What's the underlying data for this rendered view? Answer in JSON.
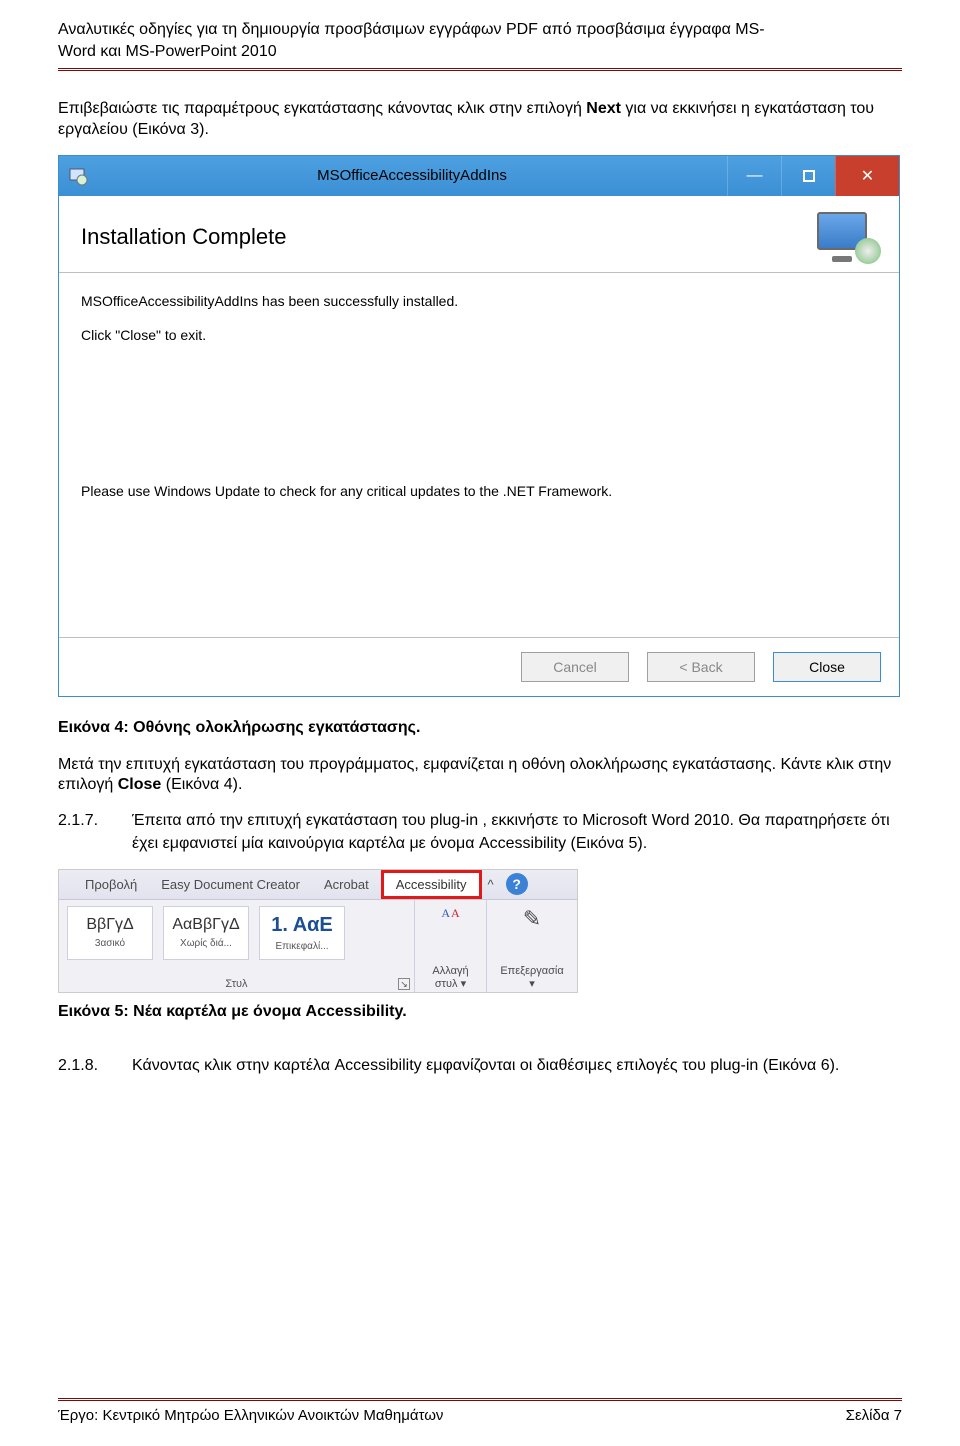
{
  "header": {
    "title_line1": "Αναλυτικές οδηγίες για τη δημιουργία προσβάσιμων εγγράφων PDF από προσβάσιμα έγγραφα MS-",
    "title_line2": "Word και MS-PowerPoint 2010"
  },
  "intro_para_pre": "Επιβεβαιώστε τις παραμέτρους εγκατάστασης κάνοντας κλικ στην επιλογή ",
  "intro_para_bold": "Next",
  "intro_para_post": " για να εκκινήσει η εγκατάσταση του εργαλείου (Εικόνα 3).",
  "installer": {
    "window_title": "MSOfficeAccessibilityAddIns",
    "heading": "Installation Complete",
    "line1": "MSOfficeAccessibilityAddIns has been successfully installed.",
    "line2": "Click \"Close\" to exit.",
    "line3": "Please use Windows Update to check for any critical updates to the .NET Framework.",
    "btn_cancel": "Cancel",
    "btn_back": "< Back",
    "btn_close": "Close"
  },
  "caption4": "Εικόνα 4: Οθόνης ολοκλήρωσης εγκατάστασης.",
  "para_after4_pre": "Μετά την επιτυχή εγκατάσταση του προγράμματος, εμφανίζεται η οθόνη ολοκλήρωσης εγκατάστασης. Κάντε κλικ στην επιλογή ",
  "para_after4_bold": "Close",
  "para_after4_post": " (Εικόνα 4).",
  "step217": {
    "num": "2.1.7.",
    "text": "Έπειτα από την επιτυχή εγκατάσταση του plug-in , εκκινήστε το Microsoft Word 2010. Θα παρατηρήσετε ότι έχει εμφανιστεί μία καινούργια καρτέλα με όνομα Accessibility (Εικόνα 5)."
  },
  "ribbon": {
    "tabs": {
      "view": "Προβολή",
      "edc": "Easy Document Creator",
      "acrobat": "Acrobat",
      "accessibility": "Accessibility",
      "chev": "^"
    },
    "styles": {
      "s1_sample": "ΒβΓγΔ",
      "s1_label": "3ασικό",
      "s2_sample": "ΑαΒβΓγΔ",
      "s2_label": "Χωρίς διά...",
      "s3_sample": "1. ΑαE",
      "s3_label": "Επικεφαλί...",
      "group_label": "Στυλ"
    },
    "change": {
      "label1": "Αλλαγή",
      "label2": "στυλ ▾"
    },
    "edit": {
      "label": "Επεξεργασία",
      "sub": "▾"
    }
  },
  "caption5": "Εικόνα 5: Νέα καρτέλα με όνομα Accessibility.",
  "step218": {
    "num": "2.1.8.",
    "text": "Κάνοντας κλικ στην καρτέλα Accessibility εμφανίζονται οι διαθέσιμες επιλογές του plug-in (Εικόνα 6)."
  },
  "footer": {
    "left": "Έργο: Κεντρικό Μητρώο Ελληνικών Ανοικτών Μαθημάτων",
    "right": "Σελίδα 7"
  }
}
